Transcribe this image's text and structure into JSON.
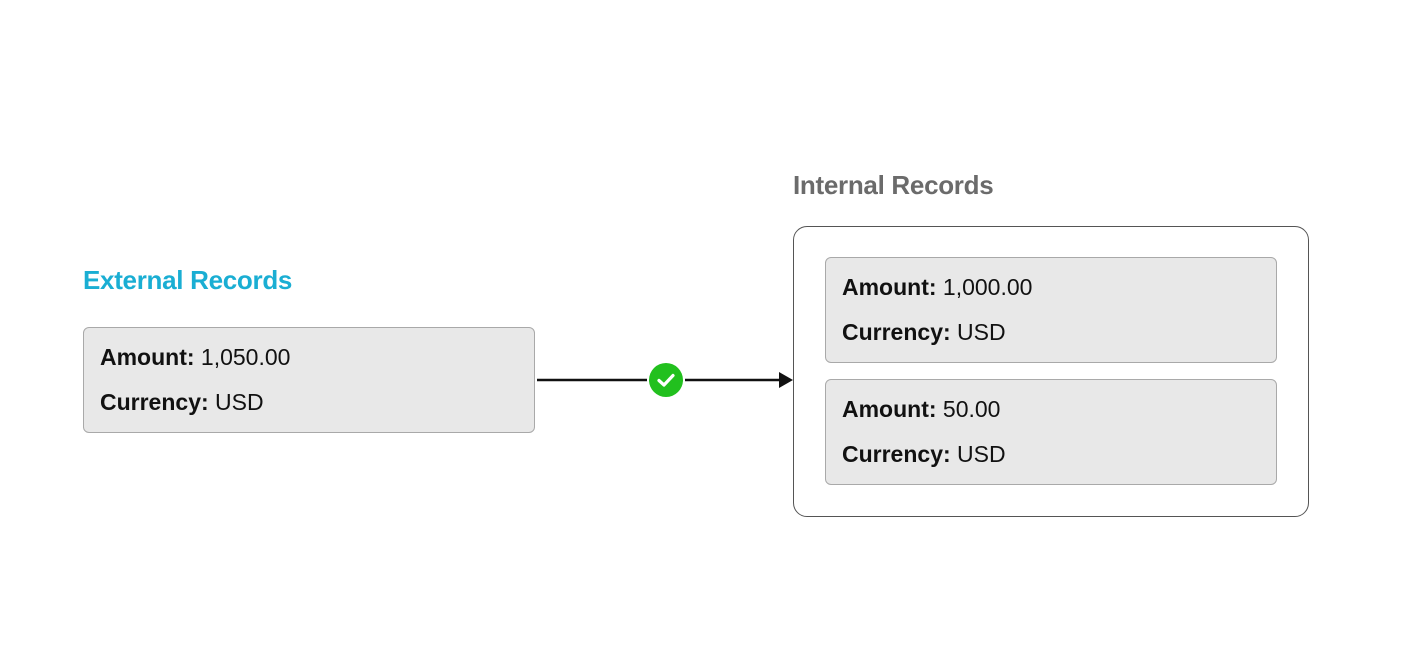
{
  "external": {
    "title": "External Records",
    "records": [
      {
        "amount_label": "Amount:",
        "amount": "1,050.00",
        "currency_label": "Currency:",
        "currency": "USD"
      }
    ]
  },
  "internal": {
    "title": "Internal Records",
    "records": [
      {
        "amount_label": "Amount:",
        "amount": "1,000.00",
        "currency_label": "Currency:",
        "currency": "USD"
      },
      {
        "amount_label": "Amount:",
        "amount": "50.00",
        "currency_label": "Currency:",
        "currency": "USD"
      }
    ]
  },
  "connector": {
    "status_icon": "check-circle-icon",
    "status_color": "#22c01e"
  },
  "colors": {
    "external_title": "#1aaed3",
    "internal_title": "#6b6b6b",
    "card_background": "#e8e8e8"
  }
}
